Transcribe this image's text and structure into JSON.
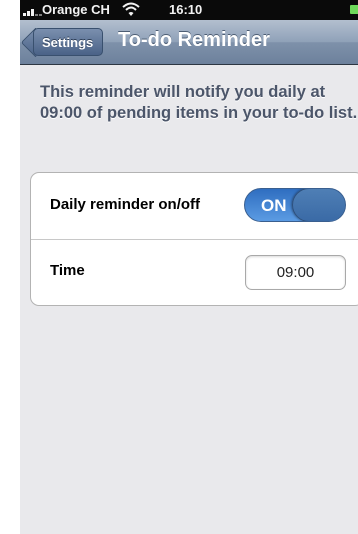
{
  "status_bar": {
    "carrier": "Orange CH",
    "time": "16:10",
    "icons": [
      "signal-bars-icon",
      "wifi-icon",
      "battery-icon"
    ]
  },
  "nav_bar": {
    "back_label": "Settings",
    "title": "To-do Reminder"
  },
  "description": "This reminder will notify you daily at 09:00 of pending items in your to-do list.",
  "settings": {
    "rows": [
      {
        "label": "Daily reminder on/off",
        "control": "toggle",
        "value": "ON"
      },
      {
        "label": "Time",
        "control": "text-field",
        "value": "09:00"
      }
    ]
  },
  "colors": {
    "nav_bar": "#8fa1b8",
    "toggle_on": "#3a7fd4",
    "background": "#e9e9ec"
  }
}
